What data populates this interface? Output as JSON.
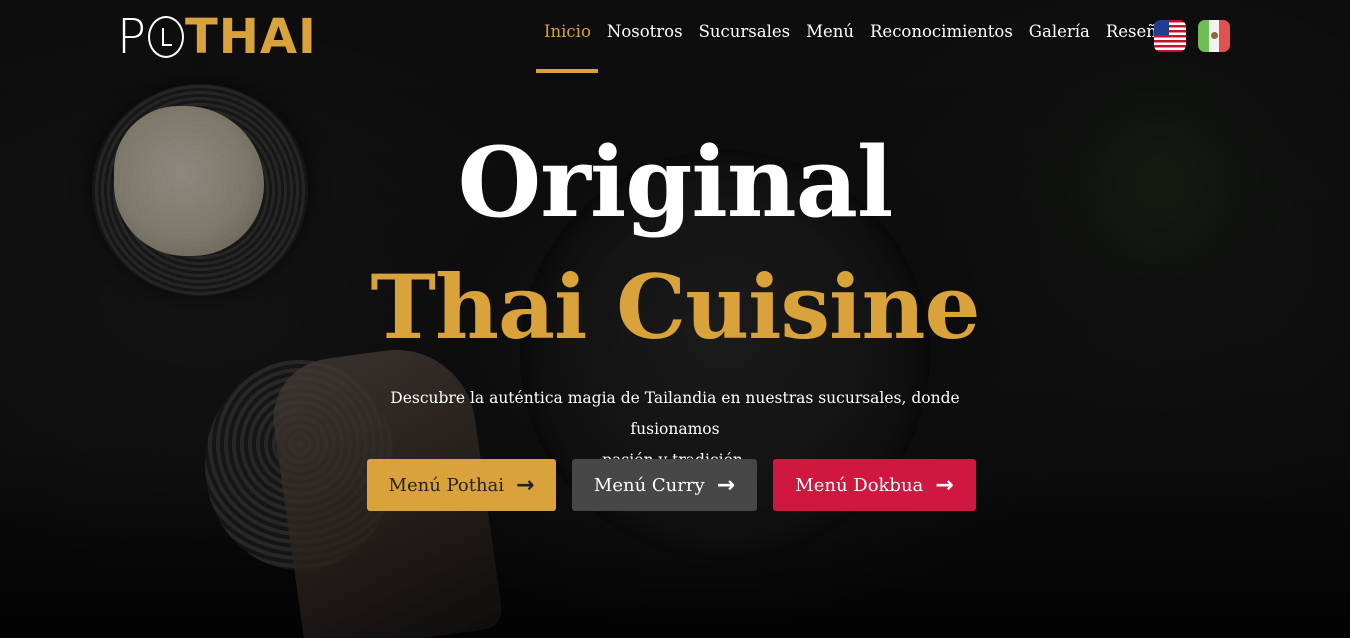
{
  "brand": {
    "logo_prefix": "P",
    "logo_suffix": "THAI",
    "accent_color": "#d9a23a"
  },
  "nav": {
    "items": [
      {
        "label": "Inicio",
        "active": true
      },
      {
        "label": "Nosotros",
        "active": false
      },
      {
        "label": "Sucursales",
        "active": false
      },
      {
        "label": "Menú",
        "active": false
      },
      {
        "label": "Reconocimientos",
        "active": false
      },
      {
        "label": "Galería",
        "active": false
      },
      {
        "label": "Reseñas",
        "active": false
      }
    ],
    "languages": [
      {
        "icon": "us-flag-icon"
      },
      {
        "icon": "mexico-flag-icon"
      }
    ]
  },
  "hero": {
    "title_line1": "Original",
    "title_line2": "Thai Cuisine",
    "description_line1": "Descubre la auténtica magia de Tailandia en nuestras sucursales, donde fusionamos",
    "description_line2": "pasión y tradición.",
    "buttons": [
      {
        "label": "Menú Pothai",
        "icon": "arrow-right-icon",
        "color": "#d9a23a"
      },
      {
        "label": "Menú Curry",
        "icon": "arrow-right-icon",
        "color": "#474747"
      },
      {
        "label": "Menú Dokbua",
        "icon": "arrow-right-icon",
        "color": "#d0173f"
      }
    ]
  },
  "arrow_glyph": "→"
}
